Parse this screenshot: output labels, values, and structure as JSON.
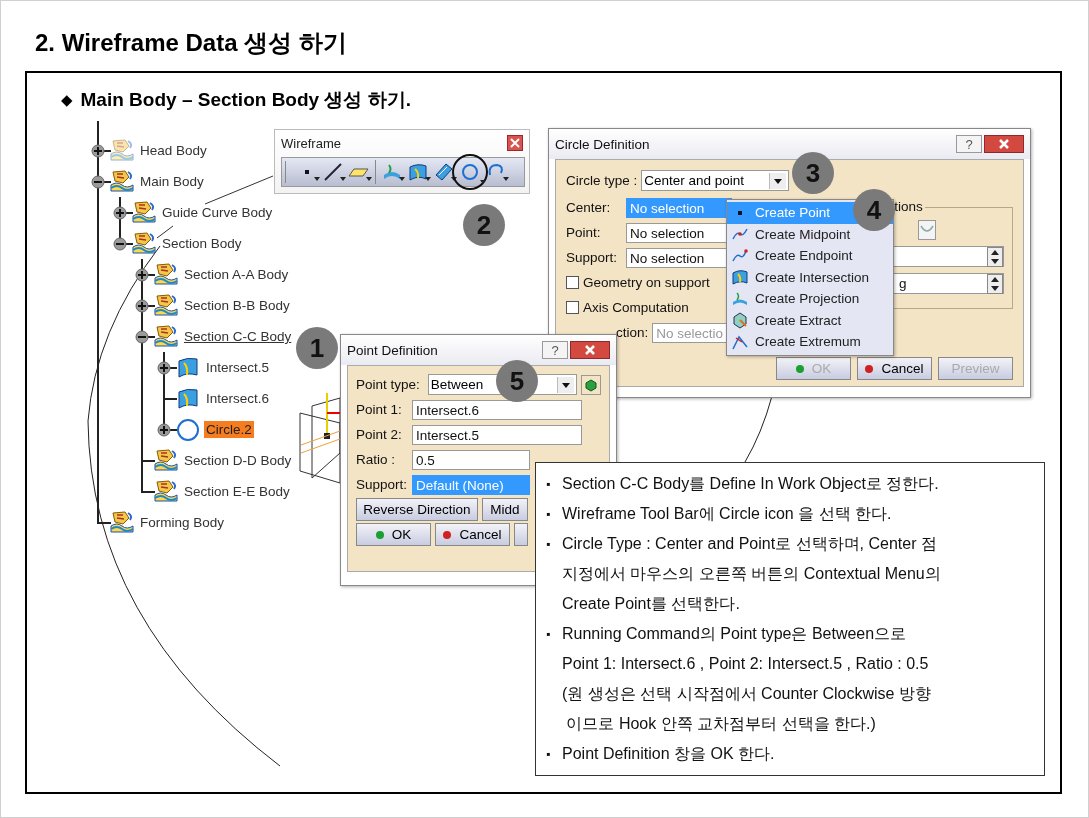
{
  "title": "2. Wireframe Data 생성 하기",
  "subtitle": {
    "bullet": "◆",
    "text": "Main Body – Section Body 생성 하기."
  },
  "tree": [
    {
      "label": "Head Body",
      "kind": "body_hidden",
      "expanded": false,
      "selected": false,
      "in_work": false
    },
    {
      "label": "Main Body",
      "kind": "body",
      "expanded": true,
      "selected": false,
      "in_work": false,
      "children": [
        {
          "label": "Guide Curve Body",
          "kind": "body",
          "expanded": false,
          "selected": false,
          "in_work": false
        },
        {
          "label": "Section Body",
          "kind": "body",
          "expanded": true,
          "selected": false,
          "in_work": false,
          "children": [
            {
              "label": "Section A-A Body",
              "kind": "body",
              "expanded": false,
              "selected": false,
              "in_work": false
            },
            {
              "label": "Section B-B Body",
              "kind": "body",
              "expanded": false,
              "selected": false,
              "in_work": false
            },
            {
              "label": "Section C-C Body",
              "kind": "body",
              "expanded": true,
              "selected": false,
              "in_work": true,
              "children": [
                {
                  "label": "Intersect.5",
                  "kind": "intersect",
                  "expanded": false,
                  "selected": false,
                  "in_work": false
                },
                {
                  "label": "Intersect.6",
                  "kind": "intersect",
                  "selected": false,
                  "in_work": false
                },
                {
                  "label": "Circle.2",
                  "kind": "circle",
                  "expanded": false,
                  "selected": true,
                  "in_work": false
                }
              ]
            },
            {
              "label": "Section D-D Body",
              "kind": "body",
              "selected": false,
              "in_work": false
            },
            {
              "label": "Section E-E Body",
              "kind": "body",
              "selected": false,
              "in_work": false
            }
          ]
        }
      ]
    },
    {
      "label": "Forming Body",
      "kind": "body",
      "selected": false,
      "in_work": false
    }
  ],
  "toolbar": {
    "title": "Wireframe",
    "tools": [
      {
        "kind": "point",
        "selected": false
      },
      {
        "kind": "line",
        "selected": false
      },
      {
        "kind": "plane",
        "selected": false
      },
      {
        "kind": "projection",
        "selected": false
      },
      {
        "kind": "intersection",
        "selected": false
      },
      {
        "kind": "surface",
        "selected": false
      },
      {
        "kind": "circle",
        "selected": true
      },
      {
        "kind": "curve",
        "selected": false
      }
    ]
  },
  "callouts": [
    "1",
    "2",
    "3",
    "4",
    "5"
  ],
  "circle_dialog": {
    "title": "Circle Definition",
    "help": "?",
    "circle_type": {
      "label": "Circle type :",
      "value": "Center and point"
    },
    "fields": [
      {
        "label": "Center:",
        "value": "No selection",
        "selected": true
      },
      {
        "label": "Point:",
        "value": "No selection",
        "selected": false
      },
      {
        "label": "Support:",
        "value": "No selection",
        "selected": false
      }
    ],
    "checkboxes": [
      {
        "label": "Geometry on support",
        "checked": false
      },
      {
        "label": "Axis Computation",
        "checked": false
      }
    ],
    "axis_direction": {
      "label": "ction:",
      "value": "No selectio",
      "disabled": true
    },
    "group_label": "tions",
    "spin_fields": [
      {
        "kind": "spin"
      },
      {
        "kind": "spin",
        "value": "g"
      }
    ],
    "buttons": [
      {
        "label": "OK",
        "kind": "ok",
        "disabled": true
      },
      {
        "label": "Cancel",
        "kind": "cancel",
        "disabled": false
      },
      {
        "label": "Preview",
        "kind": "plain",
        "disabled": true
      }
    ]
  },
  "context_menu": [
    {
      "label": "Create Point",
      "kind": "point",
      "selected": true
    },
    {
      "label": "Create Midpoint",
      "kind": "midpoint",
      "selected": false
    },
    {
      "label": "Create Endpoint",
      "kind": "endpoint",
      "selected": false
    },
    {
      "label": "Create Intersection",
      "kind": "intersection",
      "selected": false
    },
    {
      "label": "Create Projection",
      "kind": "projection",
      "selected": false
    },
    {
      "label": "Create Extract",
      "kind": "extract",
      "selected": false
    },
    {
      "label": "Create Extremum",
      "kind": "extremum",
      "selected": false
    }
  ],
  "point_dialog": {
    "title": "Point Definition",
    "help": "?",
    "point_type": {
      "label": "Point type:",
      "value": "Between"
    },
    "fields": [
      {
        "label": "Point 1:",
        "value": "Intersect.6",
        "selected": false
      },
      {
        "label": "Point 2:",
        "value": "Intersect.5",
        "selected": false
      },
      {
        "label": "Ratio :",
        "value": "0.5",
        "selected": false
      },
      {
        "label": "Support:",
        "value": "Default (None)",
        "selected": true
      }
    ],
    "option_buttons": [
      "Reverse Direction",
      "Midd"
    ],
    "buttons": [
      {
        "label": "OK",
        "kind": "ok",
        "disabled": false
      },
      {
        "label": "Cancel",
        "kind": "cancel",
        "disabled": false
      },
      {
        "kind": "plain"
      }
    ]
  },
  "instructions": [
    {
      "bullet": "▪",
      "lines": [
        "Section C-C Body를 Define In Work Object로 정한다."
      ]
    },
    {
      "bullet": "▪",
      "lines": [
        "Wireframe Tool Bar에 Circle icon 을 선택 한다."
      ]
    },
    {
      "bullet": "▪",
      "lines": [
        "Circle Type : Center and Point로 선택하며, Center 점",
        "지정에서 마우스의 오른쪽 버튼의 Contextual Menu의",
        "Create Point를 선택한다."
      ]
    },
    {
      "bullet": "▪",
      "lines": [
        "Running Command의 Point type은 Between으로",
        "Point 1: Intersect.6 , Point 2: Intersect.5 , Ratio : 0.5",
        "(원 생성은 선택 시작점에서 Counter Clockwise 방향",
        " 이므로 Hook 안쪽 교차점부터 선택을 한다.)"
      ]
    },
    {
      "bullet": "▪",
      "lines": [
        "Point Definition 창을 OK 한다."
      ]
    }
  ]
}
